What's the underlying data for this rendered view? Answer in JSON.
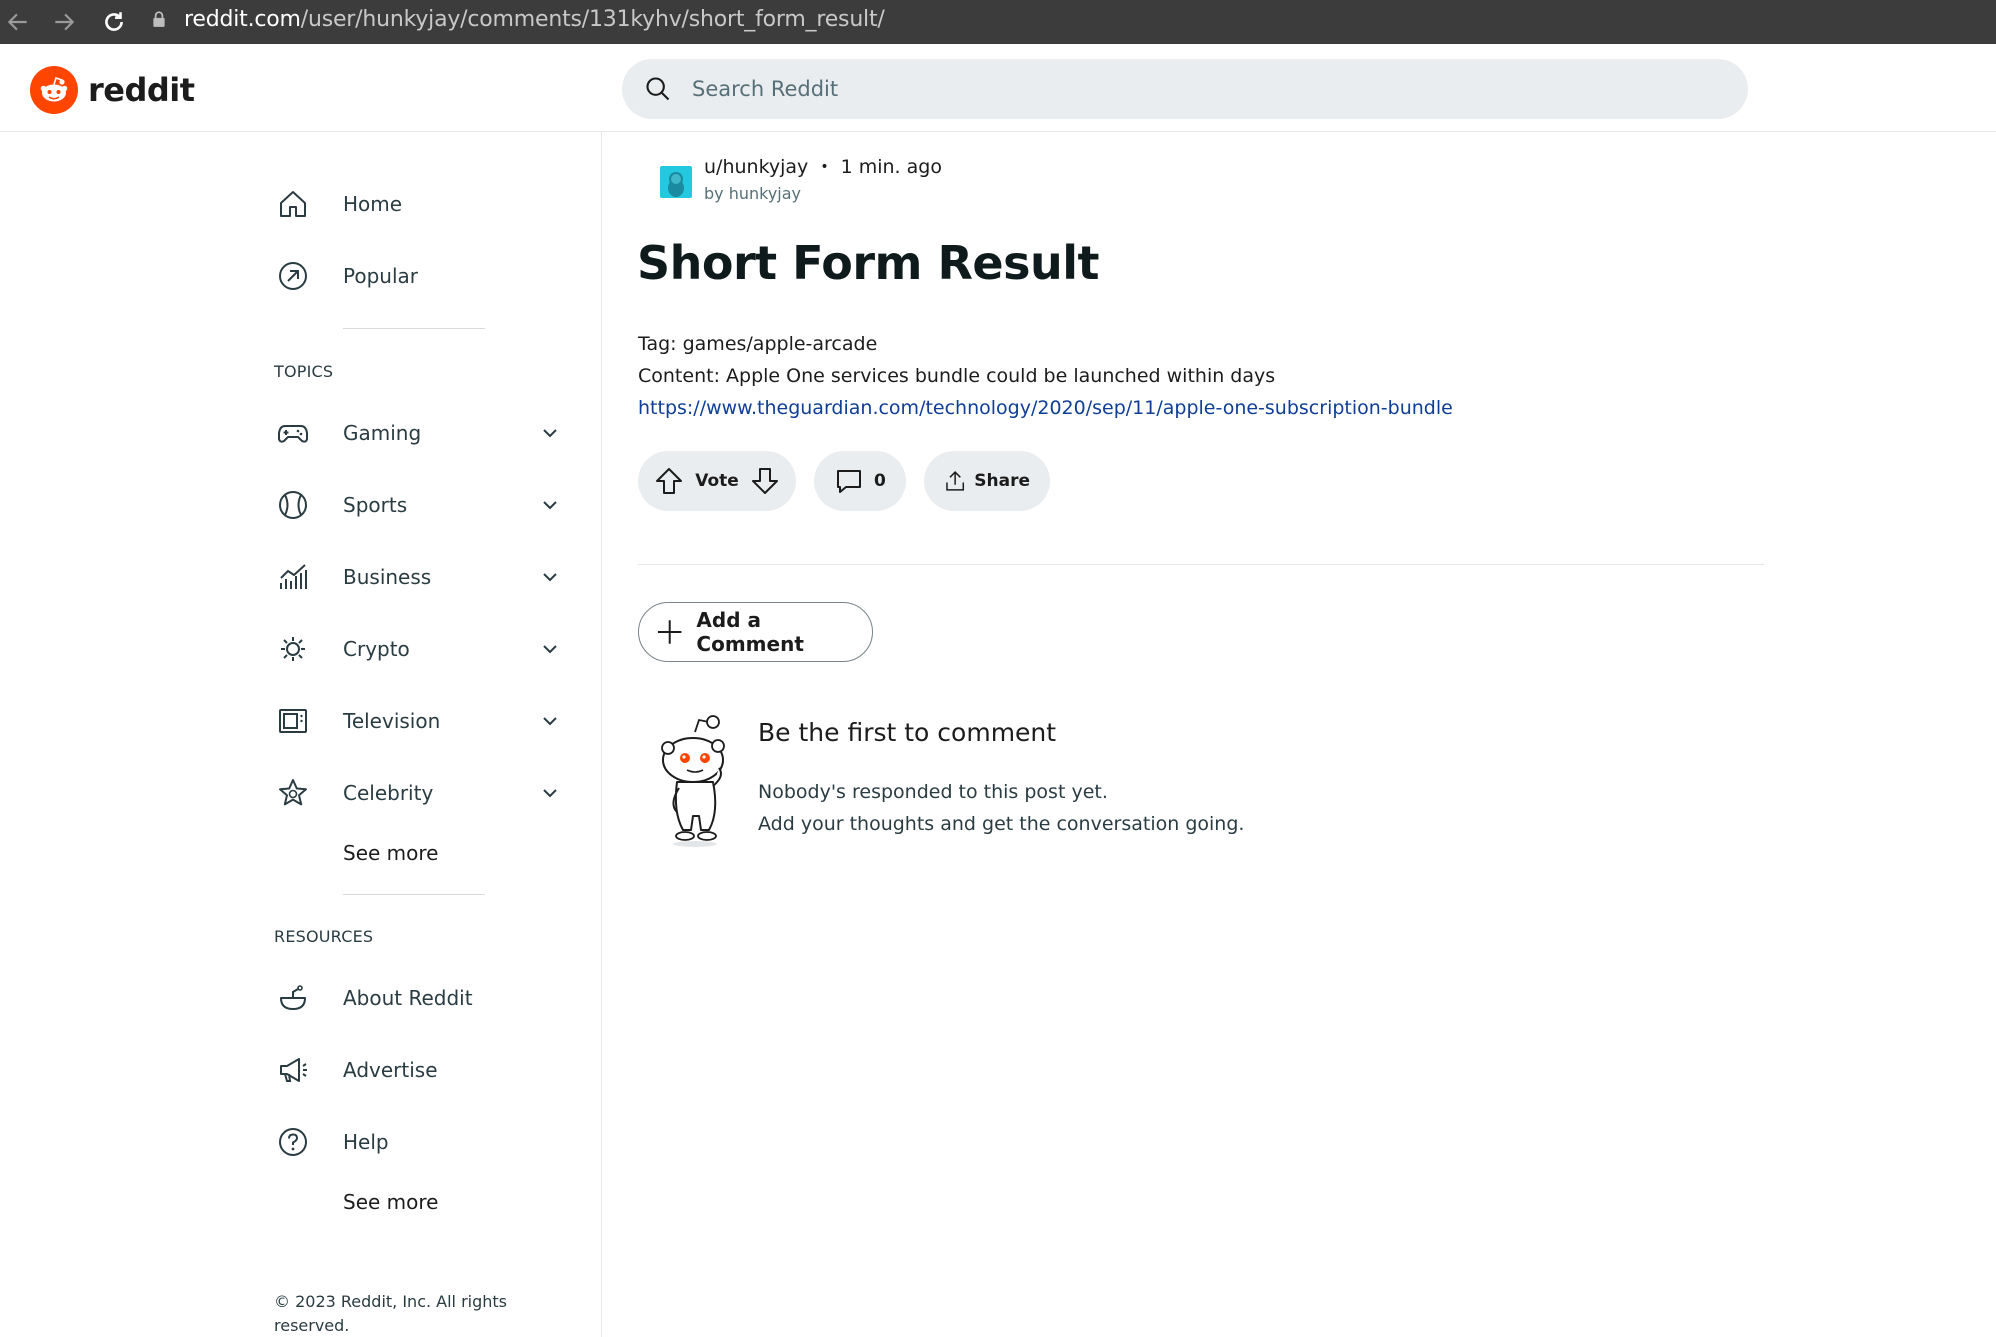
{
  "browser": {
    "url_domain": "reddit.com",
    "url_path": "/user/hunkyjay/comments/131kyhv/short_form_result/"
  },
  "header": {
    "logo_text": "reddit",
    "search_placeholder": "Search Reddit"
  },
  "sidebar": {
    "home": "Home",
    "popular": "Popular",
    "topics_title": "TOPICS",
    "topics": [
      "Gaming",
      "Sports",
      "Business",
      "Crypto",
      "Television",
      "Celebrity"
    ],
    "topics_see_more": "See more",
    "resources_title": "RESOURCES",
    "resources": [
      "About Reddit",
      "Advertise",
      "Help"
    ],
    "resources_see_more": "See more",
    "copyright": "© 2023 Reddit, Inc. All rights reserved."
  },
  "post": {
    "author": "u/hunkyjay",
    "separator": "•",
    "time": "1 min. ago",
    "by_line": "by hunkyjay",
    "title": "Short Form Result",
    "tag_line": "Tag: games/apple-arcade",
    "content_line": "Content: Apple One services bundle could be launched within days",
    "link": "https://www.theguardian.com/technology/2020/sep/11/apple-one-subscription-bundle",
    "vote_label": "Vote",
    "comment_count": "0",
    "share_label": "Share"
  },
  "comments": {
    "add_label": "Add a Comment",
    "empty_title": "Be the first to comment",
    "empty_line1": "Nobody's responded to this post yet.",
    "empty_line2": "Add your thoughts and get the conversation going."
  },
  "colors": {
    "brand": "#ff4500",
    "link": "#0e3e96",
    "pill_bg": "#eaedef",
    "avatar": "#24c9e0"
  }
}
